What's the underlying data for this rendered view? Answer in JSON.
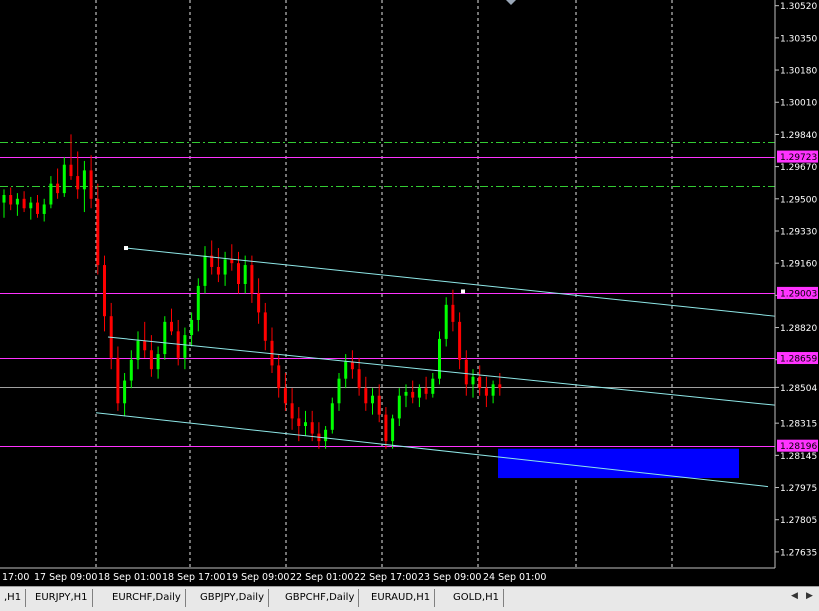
{
  "chart_data": {
    "type": "candlestick",
    "symbol_hint": "",
    "y_ticks": [
      "1.30520",
      "1.30350",
      "1.30180",
      "1.30010",
      "1.29840",
      "1.29670",
      "1.29500",
      "1.29330",
      "1.29160",
      "1.28990",
      "1.28820",
      "1.28650",
      "1.28504",
      "1.28315",
      "1.28145",
      "1.27975",
      "1.27805",
      "1.27635"
    ],
    "ylim": [
      1.2755,
      1.3055
    ],
    "current_price": "1.28504",
    "price_labels": [
      {
        "text": "1.29723",
        "price": 1.29723,
        "color": "#ff33ff"
      },
      {
        "text": "1.29003",
        "price": 1.29003,
        "color": "#ff33ff"
      },
      {
        "text": "1.28659",
        "price": 1.28659,
        "color": "#ff33ff"
      },
      {
        "text": "1.28196",
        "price": 1.28196,
        "color": "#ff33ff"
      }
    ],
    "x_labels": [
      "17:00",
      "17 Sep 09:00",
      "18 Sep 01:00",
      "18 Sep 17:00",
      "19 Sep 09:00",
      "22 Sep 01:00",
      "22 Sep 17:00",
      "23 Sep 09:00",
      "24 Sep 01:00"
    ],
    "horizontal_lines": [
      {
        "price": 1.29723,
        "color": "#ff33ff",
        "style": "solid"
      },
      {
        "price": 1.29003,
        "color": "#ff33ff",
        "style": "solid"
      },
      {
        "price": 1.28659,
        "color": "#ff33ff",
        "style": "solid"
      },
      {
        "price": 1.28196,
        "color": "#ff33ff",
        "style": "solid"
      },
      {
        "price": 1.28504,
        "color": "#a0a0a0",
        "style": "solid"
      },
      {
        "price": 1.298,
        "color": "#33cc33",
        "style": "dashdot"
      },
      {
        "price": 1.29565,
        "color": "#33cc33",
        "style": "dashdot"
      }
    ],
    "channel_lines": [
      {
        "from": [
          0.0,
          1.2924
        ],
        "to": [
          1.0,
          1.2888
        ],
        "color": "#8fe8e8"
      },
      {
        "from": [
          0.0,
          1.2877
        ],
        "to": [
          1.0,
          1.2841
        ],
        "color": "#8fe8e8"
      },
      {
        "from": [
          0.0,
          1.2837
        ],
        "to": [
          1.0,
          1.2798
        ],
        "color": "#8fe8e8"
      }
    ],
    "zone": {
      "price_top": 1.2818,
      "price_bottom": 1.28025,
      "color": "#0000ff"
    },
    "candles": [
      [
        1.2948,
        1.2955,
        1.294,
        1.2952
      ],
      [
        1.2952,
        1.2956,
        1.2944,
        1.2947
      ],
      [
        1.2947,
        1.2953,
        1.2941,
        1.295
      ],
      [
        1.295,
        1.2954,
        1.2943,
        1.2945
      ],
      [
        1.2945,
        1.2951,
        1.2939,
        1.2948
      ],
      [
        1.2948,
        1.2952,
        1.294,
        1.2942
      ],
      [
        1.2942,
        1.295,
        1.2938,
        1.2947
      ],
      [
        1.2947,
        1.2962,
        1.2945,
        1.2958
      ],
      [
        1.2958,
        1.2966,
        1.295,
        1.2953
      ],
      [
        1.2953,
        1.2972,
        1.2951,
        1.2968
      ],
      [
        1.2968,
        1.2984,
        1.296,
        1.2962
      ],
      [
        1.2962,
        1.2975,
        1.295,
        1.2955
      ],
      [
        1.2955,
        1.297,
        1.2943,
        1.2965
      ],
      [
        1.2965,
        1.2973,
        1.2945,
        1.295
      ],
      [
        1.295,
        1.2958,
        1.291,
        1.2915
      ],
      [
        1.2915,
        1.292,
        1.288,
        1.2888
      ],
      [
        1.2888,
        1.2895,
        1.286,
        1.2866
      ],
      [
        1.2866,
        1.2872,
        1.2838,
        1.2842
      ],
      [
        1.2842,
        1.2858,
        1.2835,
        1.2854
      ],
      [
        1.2854,
        1.287,
        1.285,
        1.2865
      ],
      [
        1.2865,
        1.288,
        1.286,
        1.2875
      ],
      [
        1.2875,
        1.2885,
        1.2866,
        1.287
      ],
      [
        1.287,
        1.2878,
        1.2856,
        1.286
      ],
      [
        1.286,
        1.2872,
        1.2855,
        1.2868
      ],
      [
        1.2868,
        1.2888,
        1.2865,
        1.2885
      ],
      [
        1.2885,
        1.2892,
        1.2878,
        1.288
      ],
      [
        1.288,
        1.2886,
        1.2862,
        1.2866
      ],
      [
        1.2866,
        1.2882,
        1.286,
        1.2878
      ],
      [
        1.2878,
        1.289,
        1.2872,
        1.2886
      ],
      [
        1.2886,
        1.2908,
        1.288,
        1.2904
      ],
      [
        1.2904,
        1.2925,
        1.29,
        1.292
      ],
      [
        1.292,
        1.2928,
        1.291,
        1.2914
      ],
      [
        1.2914,
        1.2924,
        1.2906,
        1.291
      ],
      [
        1.291,
        1.2922,
        1.2904,
        1.2918
      ],
      [
        1.2918,
        1.2926,
        1.2912,
        1.2916
      ],
      [
        1.2916,
        1.2922,
        1.29,
        1.2905
      ],
      [
        1.2905,
        1.292,
        1.29,
        1.2915
      ],
      [
        1.2915,
        1.292,
        1.2895,
        1.29
      ],
      [
        1.29,
        1.2908,
        1.2884,
        1.289
      ],
      [
        1.289,
        1.2895,
        1.287,
        1.2875
      ],
      [
        1.2875,
        1.2882,
        1.2858,
        1.2862
      ],
      [
        1.2862,
        1.2868,
        1.2845,
        1.285
      ],
      [
        1.285,
        1.2858,
        1.2838,
        1.2842
      ],
      [
        1.2842,
        1.285,
        1.2828,
        1.2834
      ],
      [
        1.2834,
        1.284,
        1.2822,
        1.283
      ],
      [
        1.283,
        1.2838,
        1.2825,
        1.2832
      ],
      [
        1.2832,
        1.2838,
        1.2822,
        1.2826
      ],
      [
        1.2826,
        1.2832,
        1.2818,
        1.2822
      ],
      [
        1.2822,
        1.283,
        1.2818,
        1.2828
      ],
      [
        1.2828,
        1.2845,
        1.2826,
        1.2842
      ],
      [
        1.2842,
        1.2858,
        1.2838,
        1.2855
      ],
      [
        1.2855,
        1.2868,
        1.285,
        1.2864
      ],
      [
        1.2864,
        1.287,
        1.2855,
        1.286
      ],
      [
        1.286,
        1.2866,
        1.2846,
        1.285
      ],
      [
        1.285,
        1.2856,
        1.2838,
        1.2842
      ],
      [
        1.2842,
        1.285,
        1.2836,
        1.2846
      ],
      [
        1.2846,
        1.2852,
        1.2832,
        1.2836
      ],
      [
        1.2836,
        1.284,
        1.2818,
        1.2822
      ],
      [
        1.2822,
        1.2836,
        1.2818,
        1.2834
      ],
      [
        1.2834,
        1.285,
        1.283,
        1.2846
      ],
      [
        1.2846,
        1.2852,
        1.284,
        1.2848
      ],
      [
        1.2848,
        1.2854,
        1.2842,
        1.2845
      ],
      [
        1.2845,
        1.2852,
        1.284,
        1.285
      ],
      [
        1.285,
        1.2856,
        1.2844,
        1.2847
      ],
      [
        1.2847,
        1.2858,
        1.2845,
        1.2855
      ],
      [
        1.2855,
        1.288,
        1.2852,
        1.2876
      ],
      [
        1.2876,
        1.2898,
        1.2872,
        1.2894
      ],
      [
        1.2894,
        1.2902,
        1.288,
        1.2885
      ],
      [
        1.2885,
        1.289,
        1.286,
        1.2865
      ],
      [
        1.2865,
        1.287,
        1.2846,
        1.2852
      ],
      [
        1.2852,
        1.286,
        1.2845,
        1.2856
      ],
      [
        1.2856,
        1.2862,
        1.2846,
        1.285
      ],
      [
        1.285,
        1.2856,
        1.284,
        1.2846
      ],
      [
        1.2846,
        1.2854,
        1.2842,
        1.2852
      ],
      [
        1.2852,
        1.2858,
        1.2846,
        1.285
      ]
    ]
  },
  "tabs": [
    {
      "label": ",H1"
    },
    {
      "label": "EURJPY,H1"
    },
    {
      "label": "EURCHF,Daily"
    },
    {
      "label": "GBPJPY,Daily"
    },
    {
      "label": "GBPCHF,Daily"
    },
    {
      "label": "EURAUD,H1"
    },
    {
      "label": "GOLD,H1"
    }
  ]
}
